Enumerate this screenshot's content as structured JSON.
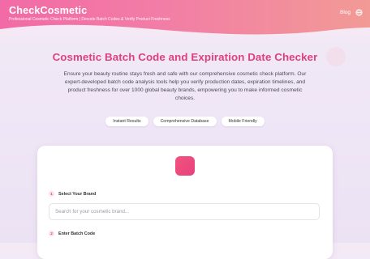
{
  "header": {
    "brand": "CheckCosmetic",
    "tagline": "Professional Cosmetic Check Platform | Decode Batch Codes & Verify Product Freshness",
    "blog_label": "Blog",
    "language_icon": "globe-icon"
  },
  "hero": {
    "title": "Cosmetic Batch Code and Expiration Date Checker",
    "description": "Ensure your beauty routine stays fresh and safe with our comprehensive cosmetic check platform. Our expert-developed batch code analysis tools help you verify production dates, expiration timelines, and product freshness for over 1000 global beauty brands, empowering you to make informed cosmetic choices."
  },
  "features": [
    "Instant Results",
    "Comprehensive Database",
    "Mobile Friendly"
  ],
  "form": {
    "step1": {
      "number": "1",
      "label": "Select Your Brand",
      "placeholder": "Search for your cosmetic brand..."
    },
    "step2": {
      "number": "2",
      "label": "Enter Batch Code"
    }
  },
  "colors": {
    "accent": "#de3f80",
    "header_gradient_start": "#f26aa6",
    "header_gradient_end": "#f29a95"
  }
}
